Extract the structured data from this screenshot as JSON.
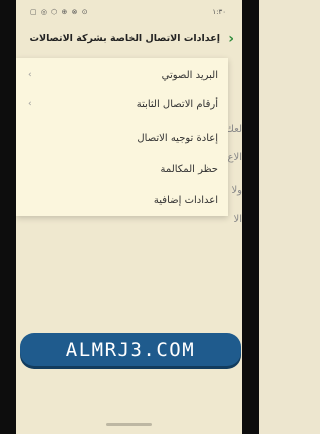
{
  "status_bar": {
    "time": "١:٣٠",
    "icons_text": "▢ ◎ ⬡ ⊕ ⊗ ⊙"
  },
  "header": {
    "title": "إعدادات الاتصال الخاصة بشركة الاتصالات",
    "back_icon": "chevron-left-icon"
  },
  "menu": {
    "items": [
      {
        "label": "البريد الصوتي",
        "chevron": "›"
      },
      {
        "label": "أرقام الاتصال الثابتة",
        "chevron": "›"
      },
      {
        "label": "إعادة توجيه الاتصال",
        "chevron": ""
      },
      {
        "label": "حظر المكالمة",
        "chevron": ""
      },
      {
        "label": "اعدادات إضافية",
        "chevron": ""
      }
    ]
  },
  "background_fragments": [
    "لعك",
    "الاع",
    "ولا",
    "الا"
  ],
  "watermark": {
    "text": "ALMRJ3.COM"
  },
  "colors": {
    "accent": "#2e8b3a",
    "banner": "#1f5b8d",
    "background": "#efe8cf",
    "menu": "#fbf6dd"
  }
}
